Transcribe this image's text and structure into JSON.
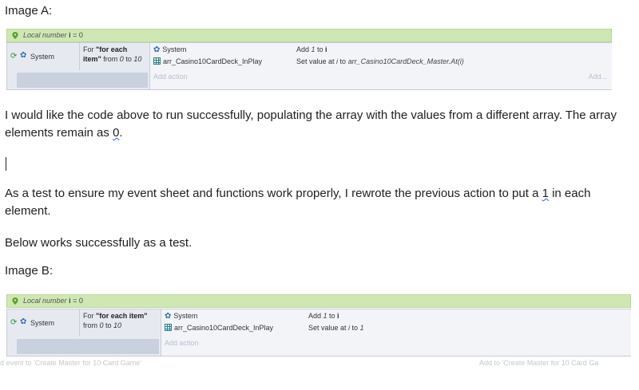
{
  "image_a": {
    "caption": "Image A:",
    "var": {
      "label": "Local number",
      "name": "i",
      "rest": " = 0"
    },
    "condition": {
      "system_label": "System",
      "for_prefix": "For ",
      "for_name": "\"for each item\"",
      "for_from": " from ",
      "from_val": "0",
      "to_word": " to ",
      "to_val": "10"
    },
    "actions": [
      {
        "object": "System",
        "text_prefix": "Add ",
        "text_val": "1",
        "text_mid": " to ",
        "text_target": "i"
      },
      {
        "object": "arr_Casino10CardDeck_InPlay",
        "text_prefix": "Set value at ",
        "text_val": "i",
        "text_mid": " to ",
        "text_target": "arr_Casino10CardDeck_Master.At(i)"
      }
    ],
    "add_action": "Add action",
    "add_right": "Add..."
  },
  "para1": {
    "text_before": " I would like the code above to run successfully, populating the array with the values from a different array.  The array elements remain as ",
    "highlight": "0",
    "text_after": "."
  },
  "para2": {
    "text_before": "As a test to ensure my event sheet and functions work properly, I rewrote the previous action to put a ",
    "highlight": "1",
    "text_after": " in each element."
  },
  "para3": "Below works successfully as a test.",
  "image_b": {
    "caption": "Image B:",
    "var": {
      "label": "Local number",
      "name": "i",
      "rest": " = 0"
    },
    "condition": {
      "system_label": "System",
      "for_prefix": "For ",
      "for_name": "\"for each item\"",
      "for_from": " from ",
      "from_val": "0",
      "to_word": " to ",
      "to_val": "10"
    },
    "actions": [
      {
        "object": "System",
        "text_prefix": "Add ",
        "text_val": "1",
        "text_mid": " to ",
        "text_target": "i"
      },
      {
        "object": "arr_Casino10CardDeck_InPlay",
        "text_prefix": "Set value at ",
        "text_val": "i",
        "text_mid": " to ",
        "text_target": "1"
      }
    ],
    "add_action": "Add action",
    "footer_left": "d event to 'Create Master for 10 Card Game'",
    "footer_right": "Add to 'Create Master for 10 Card Ga"
  },
  "colors": {
    "var_bar": "#cfe8b3",
    "event_bg": "#e6eaf0",
    "system_gear": "#2f6fb3",
    "loop_icon": "#2a8a3a"
  },
  "icons": {
    "var_pin": "map-pin-icon",
    "loop": "loop-icon",
    "system": "gear-icon",
    "array": "grid-icon"
  }
}
